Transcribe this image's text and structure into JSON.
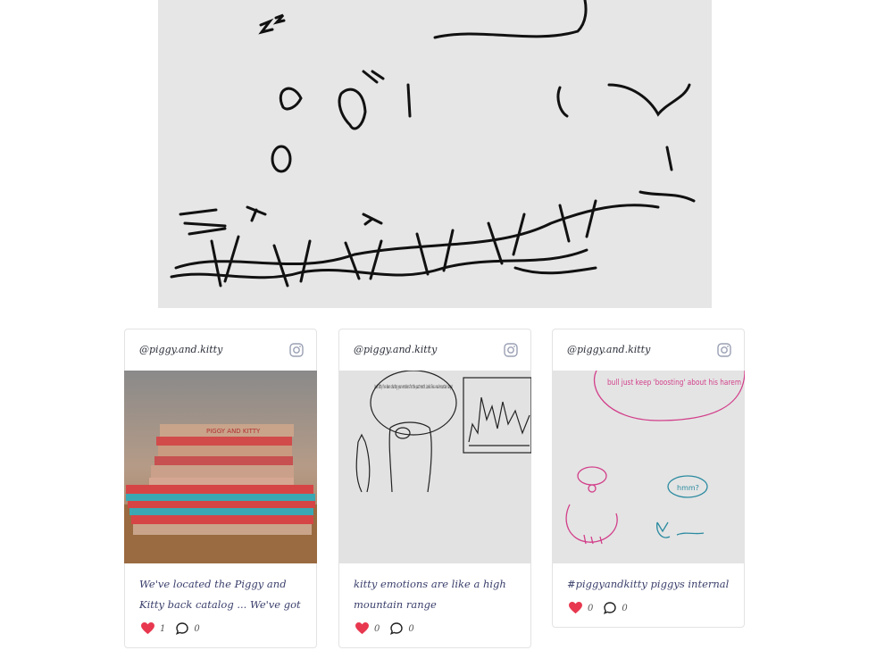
{
  "posts": [
    {
      "handle": "@piggy.and.kitty",
      "caption": "We've located the Piggy and Kitty back catalog ... We've got some big plans in t...",
      "likes": "1",
      "comments": "0",
      "image_text": "PIGGY AND KITTY"
    },
    {
      "handle": "@piggy.and.kitty",
      "caption": "kitty emotions are like a high mountain range #piggyandkitty",
      "likes": "0",
      "comments": "0",
      "image_text": "Look Kitty! I've been charting your emotions for the past month. Looks like a real mountain range!"
    },
    {
      "handle": "@piggy.and.kitty",
      "caption": "#piggyandkitty piggys internal dillema",
      "likes": "0",
      "comments": "0",
      "image_text_1": "bull just keep 'boosting' about his harem",
      "image_text_2": "hmm?"
    }
  ],
  "icons": {
    "instagram": "instagram-icon",
    "heart": "heart-icon",
    "comment": "comment-icon"
  },
  "colors": {
    "heart": "#e8384f",
    "caption": "#3a3f6b"
  }
}
